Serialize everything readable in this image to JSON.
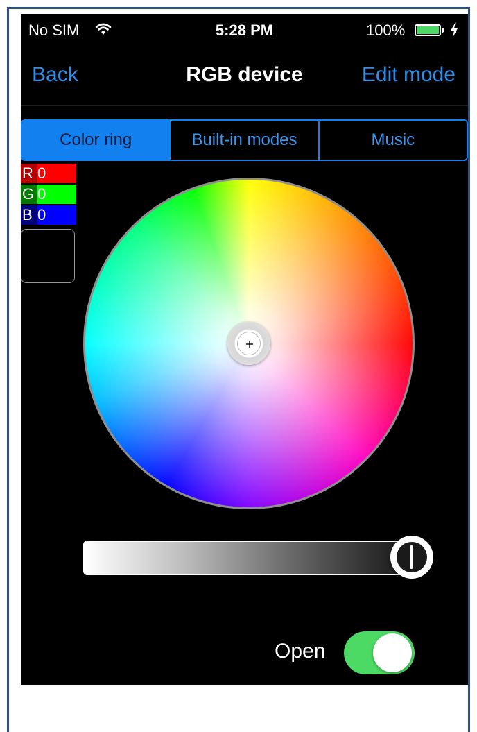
{
  "status_bar": {
    "carrier": "No SIM",
    "time": "5:28 PM",
    "battery_percent": "100%",
    "wifi_icon": "wifi-icon",
    "battery_icon": "battery-full-icon",
    "charging_icon": "charging-bolt-icon"
  },
  "nav": {
    "back_label": "Back",
    "title": "RGB device",
    "edit_label": "Edit mode"
  },
  "tabs": [
    {
      "label": "Color ring",
      "selected": true
    },
    {
      "label": "Built-in modes",
      "selected": false
    },
    {
      "label": "Music",
      "selected": false
    }
  ],
  "rgb": {
    "r_label": "R",
    "r_value": "0",
    "g_label": "G",
    "g_value": "0",
    "b_label": "B",
    "b_value": "0",
    "preview_color": "#000000"
  },
  "color_wheel": {
    "selected_color": "#ffffff"
  },
  "brightness": {
    "level": 1.0
  },
  "power": {
    "label": "Open",
    "on": true
  },
  "colors": {
    "accent": "#1280ee",
    "toggle_on": "#4cd964"
  }
}
